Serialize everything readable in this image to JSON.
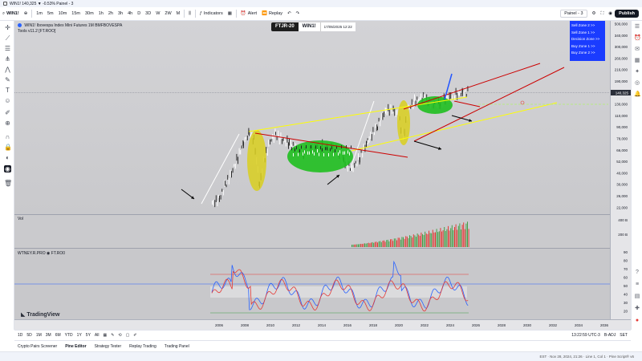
{
  "window": {
    "title": "WIN1! 140,325 ▼ -0.53% Painel - 3"
  },
  "toolbar": {
    "symbol": "WIN1!",
    "timeframes": [
      "1m",
      "5m",
      "10m",
      "15m",
      "30m",
      "1h",
      "2h",
      "3h",
      "4h",
      "D",
      "3D",
      "W",
      "2W",
      "M"
    ],
    "indicators_label": "Indicators",
    "alert_label": "Alert",
    "replay_label": "Replay",
    "layout_label": "Painel - 3",
    "publish_label": "Publish"
  },
  "chart": {
    "legend_title": "WIN1!  Ibovespa Index Mini Futures  1M  BMFBOVESPA",
    "legend_tools": "Tools v11.2 [FT.ROO]",
    "badge_left": "FTJR-20",
    "badge_right": "WIN1!",
    "badge_time": "17/05/2025 12:22",
    "zones": [
      "Sell Zone 2 >>",
      "Sell Zone 1 >>",
      "Decision Zone >>",
      "Buy Zone 1 >>",
      "Buy Zone 2 >>"
    ],
    "vol_label": "Vol",
    "osc_label": "WTNEY.R.PRO  ◉  FT.RO0",
    "current_price": "140,325",
    "tv_logo": "TradingView",
    "price_ticks": [
      "500,000",
      "340,000",
      "300,000",
      "260,000",
      "216,000",
      "190,000",
      "160,000",
      "130,000",
      "110,000",
      "90,000",
      "78,000",
      "66,000",
      "52,000",
      "40,000",
      "30,000",
      "26,000",
      "22,000"
    ],
    "vol_ticks": [
      "400 B",
      "200 B"
    ],
    "osc_ticks": [
      "90",
      "80",
      "70",
      "60",
      "50",
      "40",
      "30",
      "20"
    ],
    "time_ticks": [
      "2006",
      "2008",
      "2010",
      "2012",
      "2014",
      "2016",
      "2018",
      "2020",
      "2022",
      "2024",
      "2026",
      "2028",
      "2030",
      "2032",
      "2034",
      "2036"
    ]
  },
  "range_bar": {
    "ranges": [
      "1D",
      "5D",
      "1M",
      "3M",
      "6M",
      "YTD",
      "1Y",
      "5Y",
      "All"
    ],
    "clock": "13:22:59 UTC-3",
    "right_items": [
      "B-ADJ",
      "SET"
    ]
  },
  "bottom_tabs": [
    "Crypto Pairs Screener",
    "Pine Editor",
    "Strategy Tester",
    "Replay Trading",
    "Trading Panel"
  ],
  "status": {
    "text": "EST · Nov 28, 2024, 21:26 · Line 1, Col 1 · Pine Script® v6"
  },
  "colors": {
    "yellow_line": "#ffff00",
    "red_line": "#cc0000",
    "white_line": "#ffffff",
    "blue_line": "#2255ff",
    "green_ellipse": "#1fbf1f",
    "yellow_ellipse": "#d9cf1f",
    "zone_box": "#1a3cff"
  }
}
